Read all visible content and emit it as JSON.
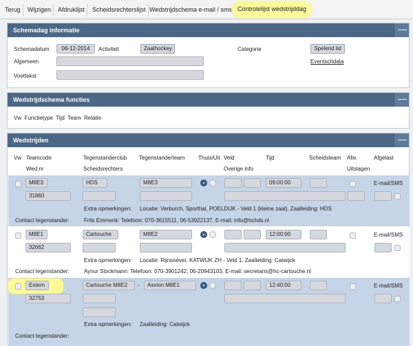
{
  "tabs": [
    {
      "label": "Terug"
    },
    {
      "label": "Wijzigen"
    },
    {
      "label": "Afdruklijst"
    },
    {
      "label": "Scheidsrechterslijst"
    },
    {
      "label": "Wedstrijdschema e-mail / sms"
    },
    {
      "label": "Controlelijst wedstrijddag"
    }
  ],
  "info": {
    "title": "Schemadag informatie",
    "collapse": "—",
    "schemadatum_label": "Schemadatum",
    "schemadatum": "06-12-2014",
    "activiteit_label": "Activiteit",
    "activiteit": "Zaalhockey",
    "categorie_label": "Categorie",
    "categorie": "Spelend lid",
    "algemeen_label": "Algemeen",
    "voettekst_label": "Voettekst",
    "eventschdata": "Eventschdata"
  },
  "functies": {
    "title": "Wedstrijdschema functies",
    "collapse": "—",
    "columns": "Vw  Functietype  Tijd  Team  Relatie"
  },
  "wedstrijden": {
    "title": "Wedstrijden",
    "collapse": "—",
    "headers": {
      "vw": "Vw",
      "teamcode": "Teamcode",
      "wednr": "Wed.nr",
      "tegenstanderclub": "Tegenstanderclub",
      "scheidsrechters": "Scheidsrechters",
      "tegenstanderteam": "Tegenstanderteam",
      "thuisuit": "Thuis/Uit",
      "veld": "Veld",
      "overige": "Overige info",
      "tijd": "Tijd",
      "scheidsteam": "Scheidsteam",
      "afw": "Afw.",
      "uitslagen": "Uitslagen",
      "afgelast": "Afgelast"
    },
    "rows": [
      {
        "teamcode": "M8E3",
        "wednr": "31860",
        "club": "HDS",
        "team": "M8E3",
        "tijd": "09:00:00",
        "afgelast": "E-mail/SMS",
        "extra_label": "Extra opmerkingen:",
        "extra": "Locatie: Verburch, Sporthal, POELDIJK - Veld 1 (kleine zaal). Zaalleiding: HDS",
        "contact_label": "Contact tegenstander:",
        "contact": "Frits Emmerik: Telefoon: 070-3615511, 06-53922137, E-mail: info@hchds.nl"
      },
      {
        "teamcode": "M8E1",
        "wednr": "32662",
        "club": "Cartouche",
        "team": "M8E2",
        "tijd": "12:00:00",
        "afgelast": "E-mail/SMS",
        "extra_label": "Extra opmerkingen:",
        "extra": "Locatie: Rijnsoever, KATWIJK ZH - Veld 1. Zaalleiding: Catwijck",
        "contact_label": "Contact tegenstander:",
        "contact": "Aynur Stockmann: Telefoon: 070-3901242, 06-20943103, E-mail: secretaris@hc-cartouche.nl"
      },
      {
        "teamcode": "Extern",
        "wednr": "32753",
        "club": "Cartouche M8E2",
        "dash": "-",
        "team": "Asvion M8E1",
        "tijd": "12:40:00",
        "afgelast": "E-mail/SMS",
        "extra_label": "Extra opmerkingen:",
        "extra": "Zaalleiding: Catwijck",
        "contact_label": "Contact tegenstander:"
      }
    ]
  },
  "colors": {
    "header": "#4c6785",
    "row_blue": "#c5d4e6",
    "highlight": "#fbf99a"
  }
}
